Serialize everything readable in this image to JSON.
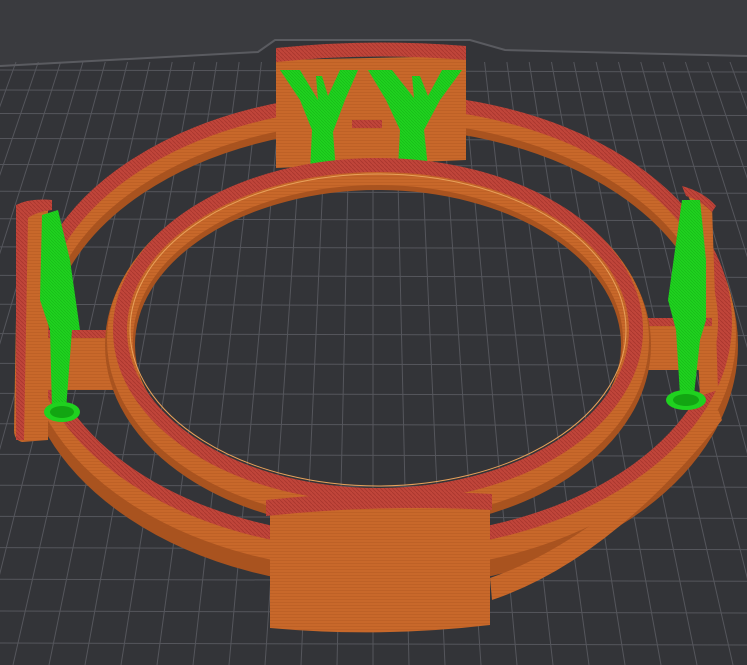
{
  "viewport": {
    "view": "3d-print-preview",
    "bed_surface": "build-plate",
    "layers_visible": true
  },
  "colors": {
    "background": "#3a3b3f",
    "bed_fill": "#333438",
    "bed_grid": "#55565c",
    "bed_grid_minor": "#45464b",
    "bed_edge": "#5a5b60",
    "perimeter_orange": "#c8682a",
    "perimeter_orange_dark": "#a9531f",
    "top_red": "#c0453a",
    "support_green": "#1fd21f",
    "support_green_dark": "#12a512"
  },
  "objects": [
    {
      "name": "ring-model",
      "part": "outer-ring"
    },
    {
      "name": "ring-model",
      "part": "inner-ring"
    },
    {
      "name": "back-tab",
      "part": "block"
    },
    {
      "name": "left-tab",
      "part": "block"
    },
    {
      "name": "right-tab",
      "part": "block"
    },
    {
      "name": "front-tab",
      "part": "block"
    },
    {
      "name": "tree-support",
      "count": 4
    }
  ]
}
